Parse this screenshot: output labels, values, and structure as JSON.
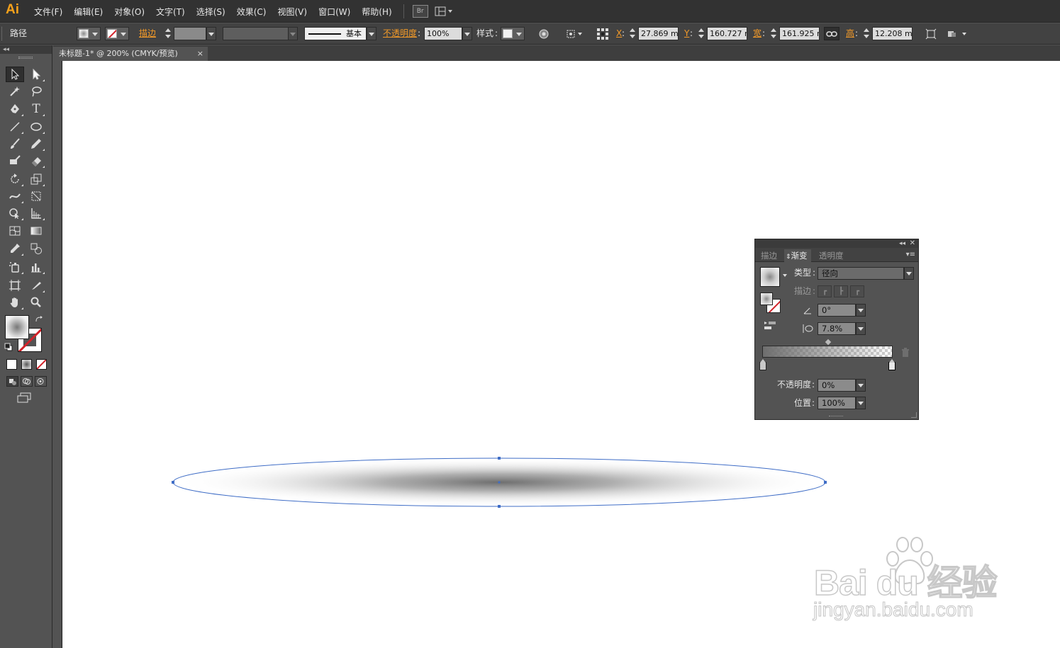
{
  "app": {
    "logo": "Ai"
  },
  "menubar": {
    "items": [
      "文件(F)",
      "编辑(E)",
      "对象(O)",
      "文字(T)",
      "选择(S)",
      "效果(C)",
      "视图(V)",
      "窗口(W)",
      "帮助(H)"
    ],
    "bridge_label": "Br"
  },
  "controlbar": {
    "selection_label": "路径",
    "stroke_label": "描边",
    "stroke_profile": "基本",
    "opacity_label": "不透明度",
    "opacity_value": "100%",
    "style_label": "样式",
    "x_label": "X",
    "x_value": "27.869 m",
    "y_label": "Y",
    "y_value": "160.727 m",
    "w_label": "宽",
    "w_value": "161.925 m",
    "h_label": "高",
    "h_value": "12.208 m"
  },
  "document": {
    "tab_title": "未标题-1* @ 200% (CMYK/预览)",
    "close_glyph": "×"
  },
  "gradient_panel": {
    "tabs": [
      "描边",
      "渐变",
      "透明度"
    ],
    "active_tab": "渐变",
    "type_label": "类型",
    "type_value": "径向",
    "stroke_label": "描边",
    "angle_value": "0°",
    "aspect_value": "7.8%",
    "opacity_label": "不透明度",
    "opacity_value": "0%",
    "position_label": "位置",
    "position_value": "100%"
  },
  "watermark": {
    "brand": "Bai du 经验",
    "url": "jingyan.baidu.com"
  },
  "colors": {
    "accent_orange": "#f39a28",
    "selection_blue": "#3f6dc6",
    "none_red": "#d2232a"
  }
}
